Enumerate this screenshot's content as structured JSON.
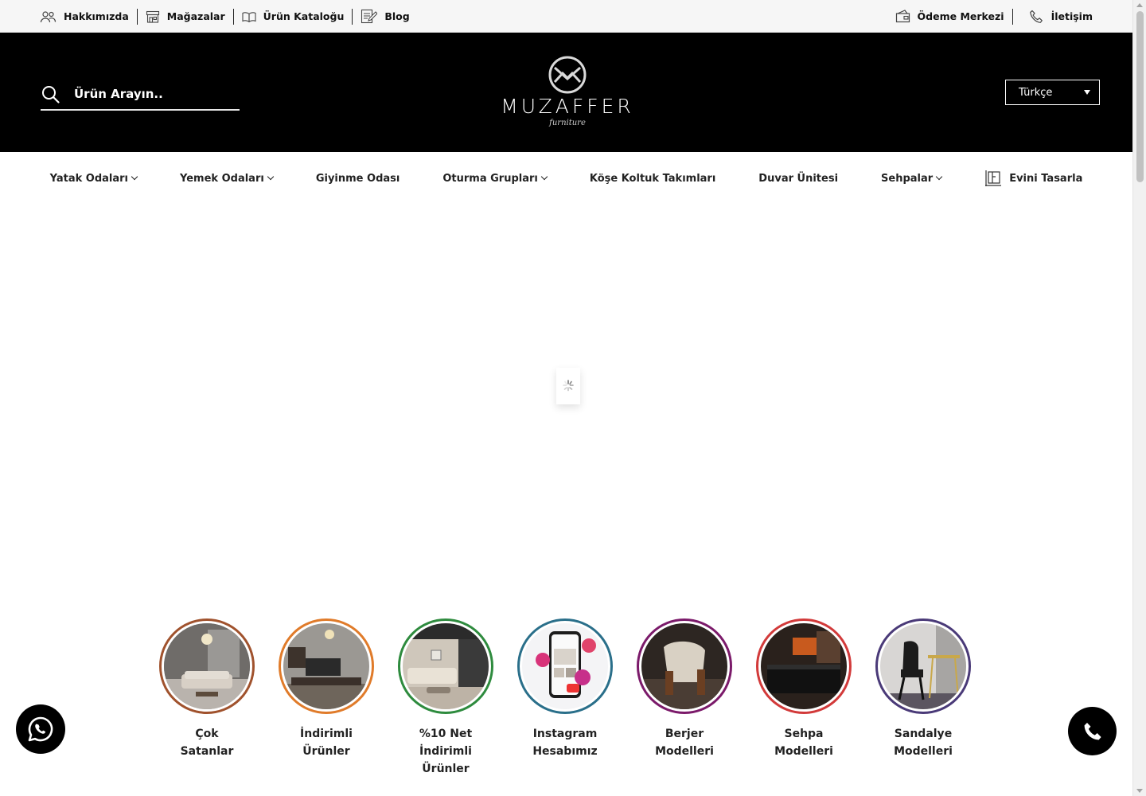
{
  "topbar": {
    "left_links": [
      {
        "label": "Hakkımızda",
        "icon": "people-icon"
      },
      {
        "label": "Mağazalar",
        "icon": "store-icon"
      },
      {
        "label": "Ürün Kataloğu",
        "icon": "book-icon"
      },
      {
        "label": "Blog",
        "icon": "edit-note-icon"
      }
    ],
    "right_links": [
      {
        "label": "Ödeme Merkezi",
        "icon": "payment-icon"
      },
      {
        "label": "İletişim",
        "icon": "phone-icon"
      }
    ]
  },
  "header": {
    "search_placeholder": "Ürün Arayın..",
    "logo_text": "MUZAFFER",
    "logo_subtext": "furniture",
    "language": "Türkçe"
  },
  "nav": {
    "items": [
      {
        "label": "Yatak Odaları",
        "has_dropdown": true
      },
      {
        "label": "Yemek Odaları",
        "has_dropdown": true
      },
      {
        "label": "Giyinme Odası",
        "has_dropdown": false
      },
      {
        "label": "Oturma Grupları",
        "has_dropdown": true
      },
      {
        "label": "Köşe Koltuk Takımları",
        "has_dropdown": false
      },
      {
        "label": "Duvar Ünitesi",
        "has_dropdown": false
      },
      {
        "label": "Sehpalar",
        "has_dropdown": true
      },
      {
        "label": "Evini Tasarla",
        "has_dropdown": false,
        "icon": "room-design-icon"
      }
    ]
  },
  "stories": [
    {
      "line1": "Çok",
      "line2": "Satanlar",
      "ring_color": "#a0522d"
    },
    {
      "line1": "İndirimli Ürünler",
      "line2": "",
      "ring_color": "#e07b2a"
    },
    {
      "line1": "%10 Net İndirimli",
      "line2": "Ürünler",
      "ring_color": "#2e8b3e"
    },
    {
      "line1": "Instagram",
      "line2": "Hesabımız",
      "ring_color": "#2a6f8a"
    },
    {
      "line1": "Berjer",
      "line2": "Modelleri",
      "ring_color": "#7b1a6a"
    },
    {
      "line1": "Sehpa",
      "line2": "Modelleri",
      "ring_color": "#d23a3a"
    },
    {
      "line1": "Sandalye",
      "line2": "Modelleri",
      "ring_color": "#4a3a78"
    }
  ],
  "floating": {
    "whatsapp_icon": "whatsapp-icon",
    "phone_icon": "phone-icon"
  }
}
